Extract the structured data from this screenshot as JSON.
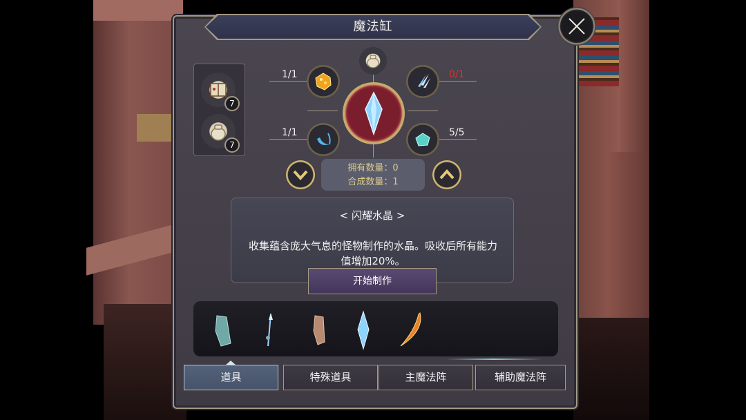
{
  "dialog": {
    "title": "魔法缸",
    "close_icon": "close-x-icon"
  },
  "recipes": [
    {
      "icon": "spellbook-icon",
      "count": "7"
    },
    {
      "icon": "pouch-icon",
      "count": "7"
    }
  ],
  "composition": {
    "top_ingredient": "pouch-icon",
    "center_item": "crystal-icon",
    "ingredients": [
      {
        "position": "top-left",
        "icon": "amber-ore-icon",
        "qty": "1/1",
        "sufficient": true
      },
      {
        "position": "top-right",
        "icon": "ice-shard-icon",
        "qty": "0/1",
        "sufficient": false
      },
      {
        "position": "bottom-left",
        "icon": "blue-claw-icon",
        "qty": "1/1",
        "sufficient": true
      },
      {
        "position": "bottom-right",
        "icon": "teal-gem-icon",
        "qty": "5/5",
        "sufficient": true
      }
    ],
    "owned_label": "拥有数量：0",
    "craft_label": "合成数量：1"
  },
  "item": {
    "name": "< 闪耀水晶 >",
    "description": "收集蕴含庞大气息的怪物制作的水晶。吸收后所有能力值增加20%。",
    "start_button": "开始制作"
  },
  "materials": [
    {
      "icon": "stone-shard-icon"
    },
    {
      "icon": "ice-wand-icon"
    },
    {
      "icon": "clay-shard-icon"
    },
    {
      "icon": "blue-crystal-icon"
    },
    {
      "icon": "fire-blade-icon"
    }
  ],
  "tabs": [
    "道具",
    "特殊道具",
    "主魔法阵",
    "辅助魔法阵"
  ],
  "active_tab": "道具",
  "colors": {
    "frame_gold": "#a39a85",
    "insufficient_red": "#e0302a",
    "count_text": "#d9c98a",
    "active_tab": "#53617a",
    "core_red": "#7a1e2e"
  }
}
